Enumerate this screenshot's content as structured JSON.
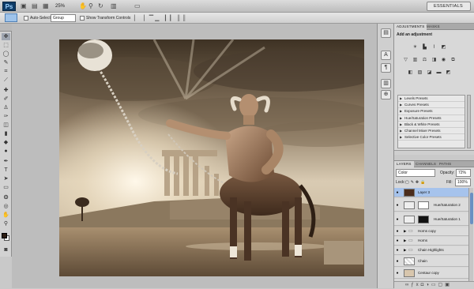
{
  "app": {
    "logo": "Ps",
    "zoom": "25%",
    "workspace": "ESSENTIALS"
  },
  "options": {
    "auto_select_label": "Auto-Select:",
    "auto_select_value": "Group",
    "show_transform": "Show Transform Controls"
  },
  "adjustments": {
    "tabs": [
      "ADJUSTMENTS",
      "MASKS"
    ],
    "title": "Add an adjustment",
    "presets": [
      "Levels Presets",
      "Curves Presets",
      "Exposure Presets",
      "Hue/Saturation Presets",
      "Black & White Presets",
      "Channel Mixer Presets",
      "Selective Color Presets"
    ]
  },
  "layers": {
    "tabs": [
      "LAYERS",
      "CHANNELS",
      "PATHS"
    ],
    "blend_mode": "Color",
    "opacity_label": "Opacity:",
    "opacity_value": "72%",
    "lock_label": "Lock:",
    "fill_label": "Fill:",
    "fill_value": "100%",
    "items": [
      {
        "name": "Layer 3",
        "selected": true
      },
      {
        "name": "Hue/Saturation 2",
        "selected": false
      },
      {
        "name": "Hue/Saturation 1",
        "selected": false
      },
      {
        "name": "Horns copy",
        "selected": false
      },
      {
        "name": "Horns",
        "selected": false
      },
      {
        "name": "Chain Highlights",
        "selected": false
      },
      {
        "name": "Chain",
        "selected": false
      },
      {
        "name": "Centaur copy",
        "selected": false
      }
    ]
  }
}
